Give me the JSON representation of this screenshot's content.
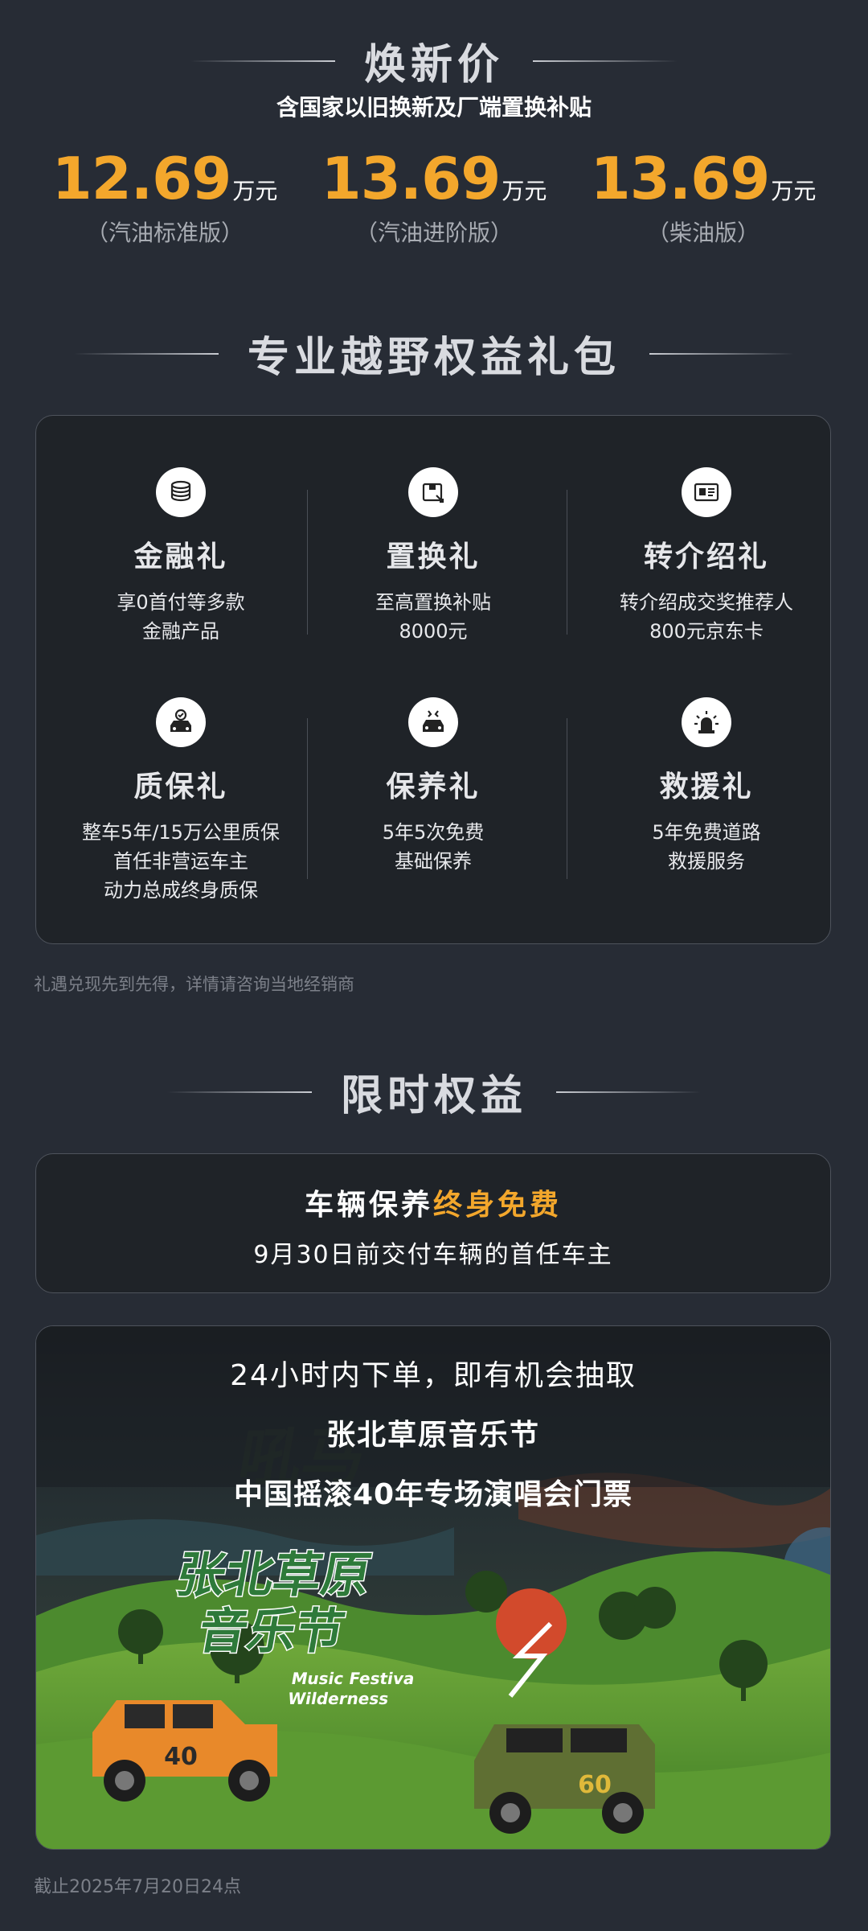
{
  "price_section": {
    "title": "焕新价",
    "subtitle": "含国家以旧换新及厂端置换补贴",
    "prices": [
      {
        "amount": "12.69",
        "unit": "万元",
        "version": "（汽油标准版）"
      },
      {
        "amount": "13.69",
        "unit": "万元",
        "version": "（汽油进阶版）"
      },
      {
        "amount": "13.69",
        "unit": "万元",
        "version": "（柴油版）"
      }
    ]
  },
  "gift_section": {
    "title": "专业越野权益礼包",
    "items": [
      {
        "icon": "coins-icon",
        "name": "金融礼",
        "lines": [
          "享0首付等多款",
          "金融产品"
        ]
      },
      {
        "icon": "trade-in-box-icon",
        "name": "置换礼",
        "lines": [
          "至高置换补贴",
          "8000元"
        ]
      },
      {
        "icon": "referral-card-icon",
        "name": "转介绍礼",
        "lines": [
          "转介绍成交奖推荐人",
          "800元京东卡"
        ]
      },
      {
        "icon": "car-warranty-icon",
        "name": "质保礼",
        "lines": [
          "整车5年/15万公里质保",
          "首任非营运车主",
          "动力总成终身质保"
        ]
      },
      {
        "icon": "car-maintenance-icon",
        "name": "保养礼",
        "lines": [
          "5年5次免费",
          "基础保养"
        ]
      },
      {
        "icon": "rescue-beacon-icon",
        "name": "救援礼",
        "lines": [
          "5年免费道路",
          "救援服务"
        ]
      }
    ],
    "note": "礼遇兑现先到先得，详情请咨询当地经销商"
  },
  "limited_section": {
    "title": "限时权益",
    "maintenance": {
      "title_prefix": "车辆保养",
      "title_highlight": "终身免费",
      "subtitle": "9月30日前交付车辆的首任车主"
    },
    "festival": {
      "line1": "24小时内下单，即有机会抽取",
      "line2": "张北草原音乐节",
      "line3": "中国摇滚40年专场演唱会门票",
      "logo_text_cn": "张北草原 音乐节",
      "logo_text_en": "Music Festival Wilderness",
      "car1_badge": "40",
      "car2_badge": "60"
    },
    "deadline": "截止2025年7月20日24点"
  },
  "colors": {
    "background": "#272c35",
    "accent_orange": "#f3a72c",
    "card_bg": "#1f2328"
  }
}
